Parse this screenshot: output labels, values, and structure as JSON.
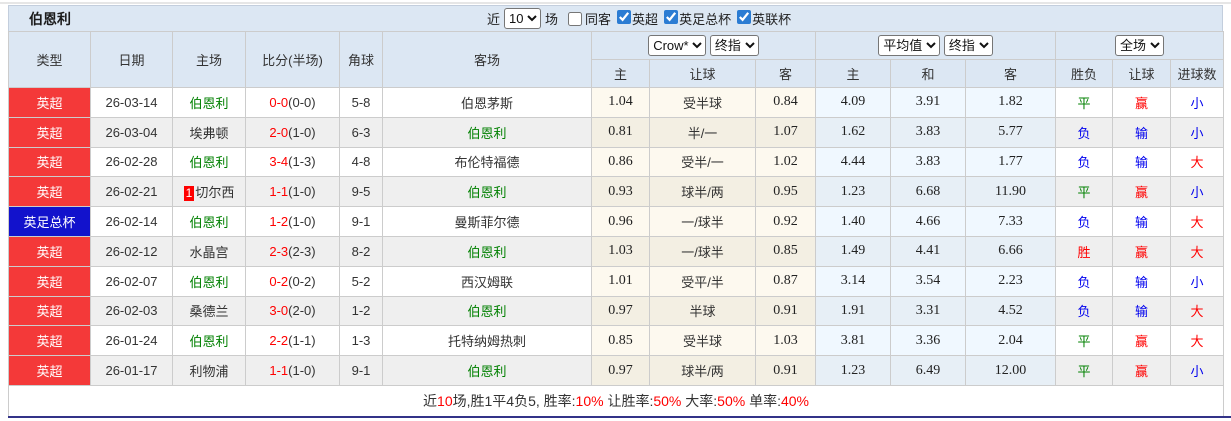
{
  "page": {
    "title": "伯恩利",
    "filter": {
      "near_label": "近",
      "match_count": "10",
      "games_label": "场",
      "same_venue_label": "同客",
      "leagues": [
        {
          "label": "英超",
          "checked": true
        },
        {
          "label": "英足总杯",
          "checked": true
        },
        {
          "label": "英联杯",
          "checked": true
        }
      ]
    }
  },
  "columns": {
    "left": [
      "类型",
      "日期",
      "主场",
      "比分(半场)",
      "角球",
      "客场"
    ],
    "odds_selects": [
      "Crow*",
      "终指"
    ],
    "odds_cols": [
      "主",
      "让球",
      "客"
    ],
    "avg_selects": [
      "平均值",
      "终指"
    ],
    "avg_cols": [
      "主",
      "和",
      "客"
    ],
    "result_select": "全场",
    "result_cols": [
      "胜负",
      "让球",
      "进球数"
    ]
  },
  "colors": {
    "league_premier": "#f43939",
    "league_facup": "#1212cc",
    "self_team_green": "#008000",
    "score_red": "#ff0000",
    "win_red": "#ff0000",
    "lose_blue": "#0000ee",
    "draw_green": "#008000",
    "header_bg": "#dce7f3",
    "odds_bg": "#fdf9ef",
    "avg_bg": "#f0f8ff"
  },
  "rows": [
    {
      "league": "英超",
      "league_type": "red",
      "date": "26-03-14",
      "home": "伯恩利",
      "home_self": true,
      "home_rank": "",
      "score": "0-0",
      "half": "(0-0)",
      "corner": "5-8",
      "away": "伯恩茅斯",
      "away_self": false,
      "odds": [
        "1.04",
        "受半球",
        "0.84"
      ],
      "avg": [
        "4.09",
        "3.91",
        "1.82"
      ],
      "results": [
        [
          "平",
          "green"
        ],
        [
          "赢",
          "red"
        ],
        [
          "小",
          "blue"
        ]
      ]
    },
    {
      "league": "英超",
      "league_type": "red",
      "date": "26-03-04",
      "home": "埃弗顿",
      "home_self": false,
      "home_rank": "",
      "score": "2-0",
      "half": "(1-0)",
      "corner": "6-3",
      "away": "伯恩利",
      "away_self": true,
      "odds": [
        "0.81",
        "半/一",
        "1.07"
      ],
      "avg": [
        "1.62",
        "3.83",
        "5.77"
      ],
      "results": [
        [
          "负",
          "blue"
        ],
        [
          "输",
          "blue"
        ],
        [
          "小",
          "blue"
        ]
      ]
    },
    {
      "league": "英超",
      "league_type": "red",
      "date": "26-02-28",
      "home": "伯恩利",
      "home_self": true,
      "home_rank": "",
      "score": "3-4",
      "half": "(1-3)",
      "corner": "4-8",
      "away": "布伦特福德",
      "away_self": false,
      "odds": [
        "0.86",
        "受半/一",
        "1.02"
      ],
      "avg": [
        "4.44",
        "3.83",
        "1.77"
      ],
      "results": [
        [
          "负",
          "blue"
        ],
        [
          "输",
          "blue"
        ],
        [
          "大",
          "red"
        ]
      ]
    },
    {
      "league": "英超",
      "league_type": "red",
      "date": "26-02-21",
      "home": "切尔西",
      "home_self": false,
      "home_rank": "1",
      "score": "1-1",
      "half": "(1-0)",
      "corner": "9-5",
      "away": "伯恩利",
      "away_self": true,
      "odds": [
        "0.93",
        "球半/两",
        "0.95"
      ],
      "avg": [
        "1.23",
        "6.68",
        "11.90"
      ],
      "results": [
        [
          "平",
          "green"
        ],
        [
          "赢",
          "red"
        ],
        [
          "小",
          "blue"
        ]
      ]
    },
    {
      "league": "英足总杯",
      "league_type": "blue",
      "date": "26-02-14",
      "home": "伯恩利",
      "home_self": true,
      "home_rank": "",
      "score": "1-2",
      "half": "(1-0)",
      "corner": "9-1",
      "away": "曼斯菲尔德",
      "away_self": false,
      "odds": [
        "0.96",
        "一/球半",
        "0.92"
      ],
      "avg": [
        "1.40",
        "4.66",
        "7.33"
      ],
      "results": [
        [
          "负",
          "blue"
        ],
        [
          "输",
          "blue"
        ],
        [
          "大",
          "red"
        ]
      ]
    },
    {
      "league": "英超",
      "league_type": "red",
      "date": "26-02-12",
      "home": "水晶宫",
      "home_self": false,
      "home_rank": "",
      "score": "2-3",
      "half": "(2-3)",
      "corner": "8-2",
      "away": "伯恩利",
      "away_self": true,
      "odds": [
        "1.03",
        "一/球半",
        "0.85"
      ],
      "avg": [
        "1.49",
        "4.41",
        "6.66"
      ],
      "results": [
        [
          "胜",
          "red"
        ],
        [
          "赢",
          "red"
        ],
        [
          "大",
          "red"
        ]
      ]
    },
    {
      "league": "英超",
      "league_type": "red",
      "date": "26-02-07",
      "home": "伯恩利",
      "home_self": true,
      "home_rank": "",
      "score": "0-2",
      "half": "(0-2)",
      "corner": "5-2",
      "away": "西汉姆联",
      "away_self": false,
      "odds": [
        "1.01",
        "受平/半",
        "0.87"
      ],
      "avg": [
        "3.14",
        "3.54",
        "2.23"
      ],
      "results": [
        [
          "负",
          "blue"
        ],
        [
          "输",
          "blue"
        ],
        [
          "小",
          "blue"
        ]
      ]
    },
    {
      "league": "英超",
      "league_type": "red",
      "date": "26-02-03",
      "home": "桑德兰",
      "home_self": false,
      "home_rank": "",
      "score": "3-0",
      "half": "(2-0)",
      "corner": "1-2",
      "away": "伯恩利",
      "away_self": true,
      "odds": [
        "0.97",
        "半球",
        "0.91"
      ],
      "avg": [
        "1.91",
        "3.31",
        "4.52"
      ],
      "results": [
        [
          "负",
          "blue"
        ],
        [
          "输",
          "blue"
        ],
        [
          "大",
          "red"
        ]
      ]
    },
    {
      "league": "英超",
      "league_type": "red",
      "date": "26-01-24",
      "home": "伯恩利",
      "home_self": true,
      "home_rank": "",
      "score": "2-2",
      "half": "(1-1)",
      "corner": "1-3",
      "away": "托特纳姆热刺",
      "away_self": false,
      "odds": [
        "0.85",
        "受半球",
        "1.03"
      ],
      "avg": [
        "3.81",
        "3.36",
        "2.04"
      ],
      "results": [
        [
          "平",
          "green"
        ],
        [
          "赢",
          "red"
        ],
        [
          "大",
          "red"
        ]
      ]
    },
    {
      "league": "英超",
      "league_type": "red",
      "date": "26-01-17",
      "home": "利物浦",
      "home_self": false,
      "home_rank": "",
      "score": "1-1",
      "half": "(1-0)",
      "corner": "9-1",
      "away": "伯恩利",
      "away_self": true,
      "odds": [
        "0.97",
        "球半/两",
        "0.91"
      ],
      "avg": [
        "1.23",
        "6.49",
        "12.00"
      ],
      "results": [
        [
          "平",
          "green"
        ],
        [
          "赢",
          "red"
        ],
        [
          "小",
          "blue"
        ]
      ]
    }
  ],
  "footer_segments": [
    {
      "text": "近",
      "red": false
    },
    {
      "text": "10",
      "red": true
    },
    {
      "text": "场,胜1平4负5, 胜率:",
      "red": false
    },
    {
      "text": "10%",
      "red": true
    },
    {
      "text": " 让胜率:",
      "red": false
    },
    {
      "text": "50%",
      "red": true
    },
    {
      "text": " 大率:",
      "red": false
    },
    {
      "text": "50%",
      "red": true
    },
    {
      "text": " 单率:",
      "red": false
    },
    {
      "text": "40%",
      "red": true
    }
  ]
}
